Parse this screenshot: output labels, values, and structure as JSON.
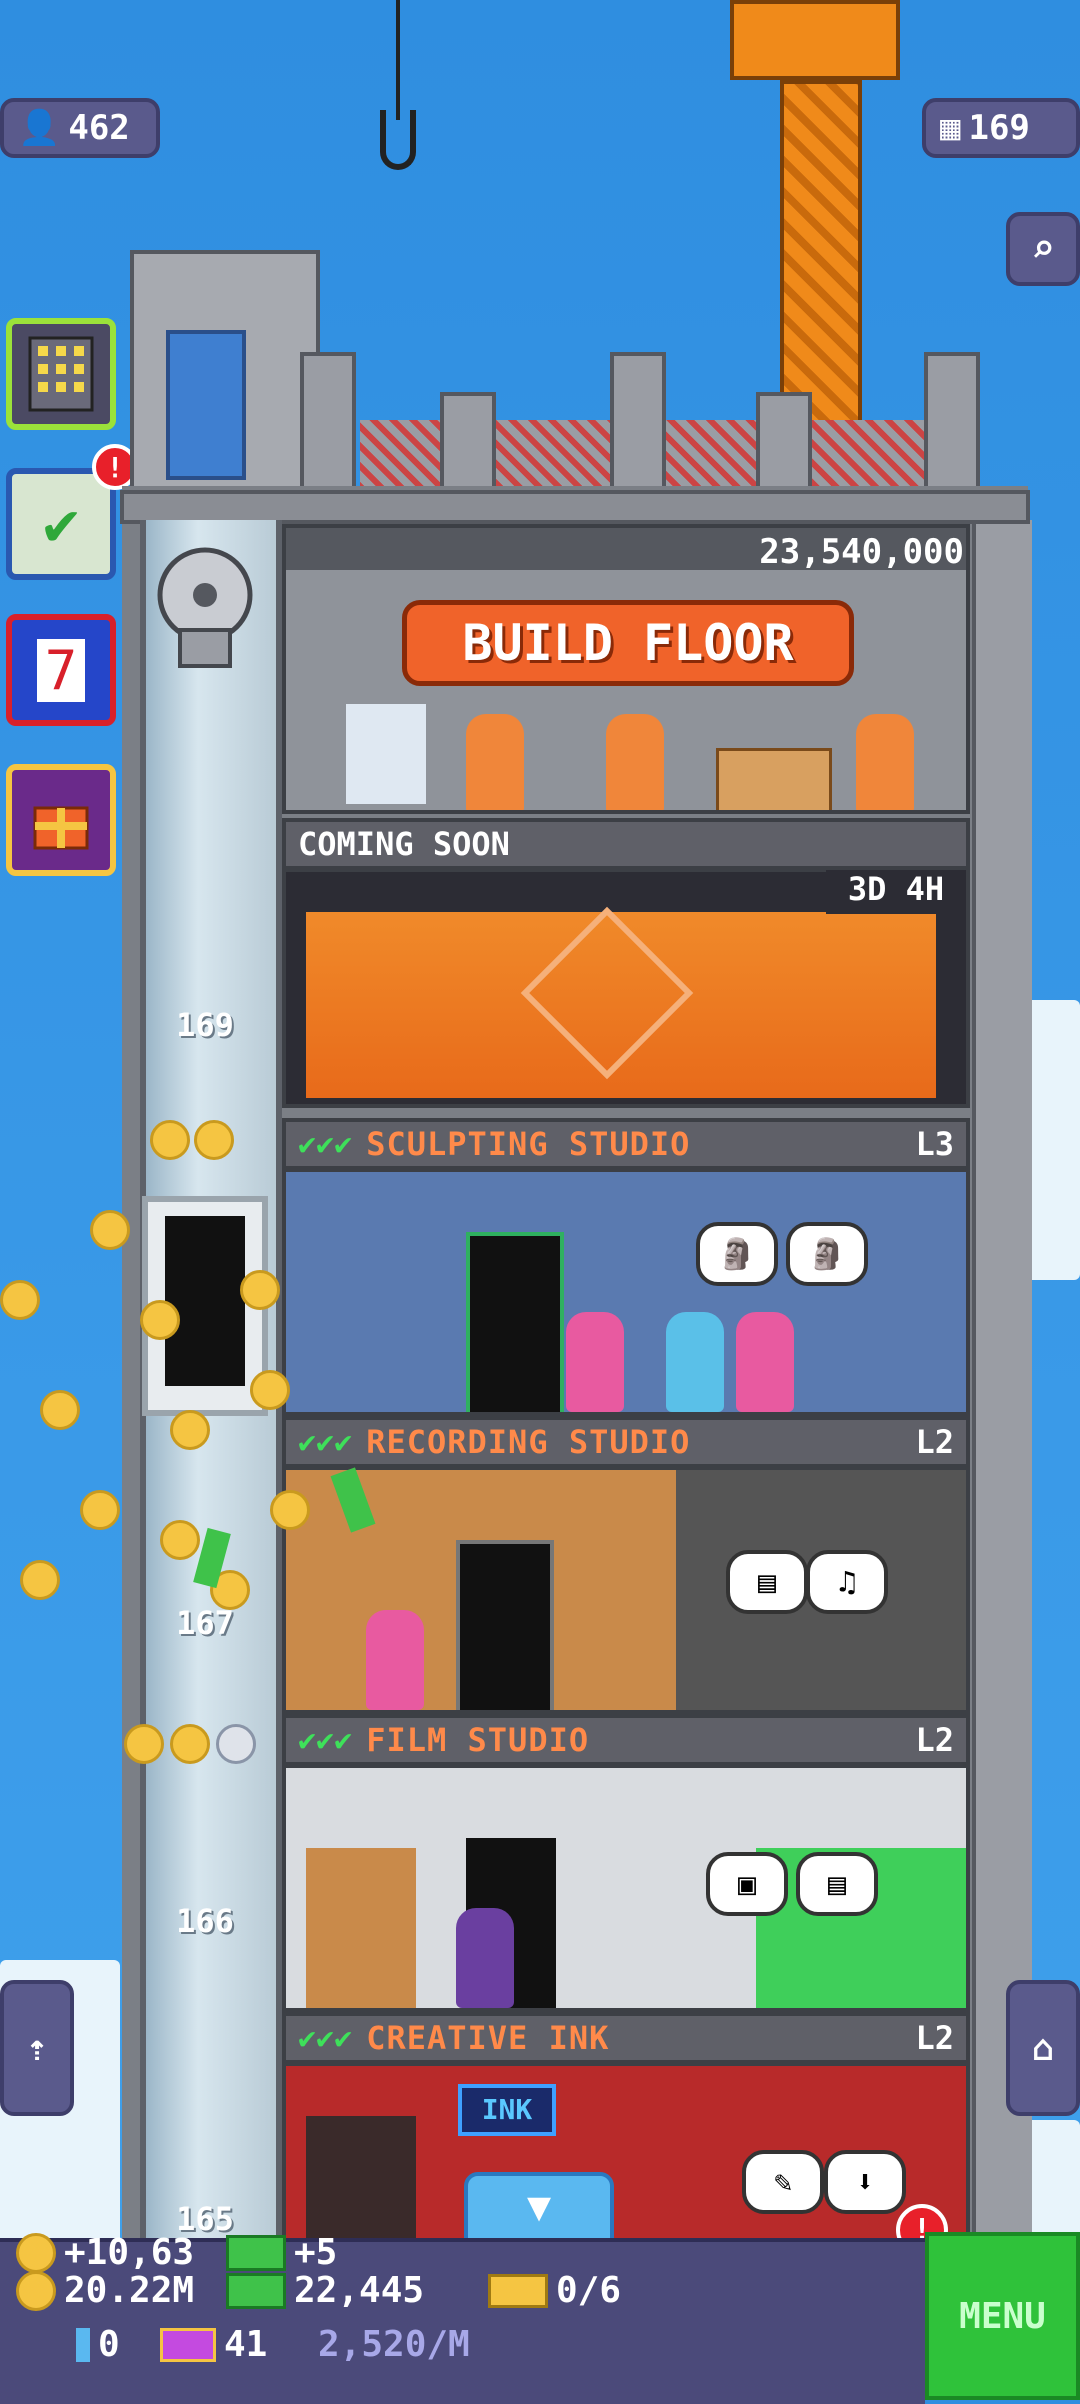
{
  "hud": {
    "residents": "462",
    "floors": "169"
  },
  "build": {
    "cost": "23,540,000",
    "button_label": "BUILD FLOOR"
  },
  "coming_soon": {
    "label": "COMING SOON",
    "timer": "3D 4H"
  },
  "floors": [
    {
      "name": "SCULPTING STUDIO",
      "level": "L3",
      "checks": "✔✔✔"
    },
    {
      "name": "RECORDING STUDIO",
      "level": "L2",
      "checks": "✔✔✔"
    },
    {
      "name": "FILM STUDIO",
      "level": "L2",
      "checks": "✔✔✔"
    },
    {
      "name": "CREATIVE INK",
      "level": "L2",
      "checks": "✔✔✔"
    }
  ],
  "elevator": {
    "numbers": [
      "169",
      "167",
      "166",
      "165"
    ]
  },
  "signs": {
    "ink": "INK"
  },
  "badges": {
    "missions_alert": "!",
    "bottom_alert": "!"
  },
  "stats": {
    "coins_rate": "+10,63",
    "bux_rate": "+5",
    "coins": "20.22M",
    "bux": "22,445",
    "tickets": "0/6",
    "keys": "0",
    "gold_tickets": "41",
    "income": "2,520/M"
  },
  "menu_label": "MENU",
  "colors": {
    "sky": "#2f8ee0",
    "build_button": "#f0632a",
    "floor_label_name": "#ff8a4a",
    "menu_button": "#2fc23a",
    "check": "#3ee05a"
  },
  "icons": [
    "person-icon",
    "building-icon",
    "search-icon",
    "floors-icon",
    "missions-icon",
    "calendar-icon",
    "gift-icon",
    "elevator-down-icon",
    "scroll-up-icon",
    "scroll-down-icon",
    "coin-icon",
    "bux-icon",
    "ticket-icon",
    "key-icon",
    "gold-ticket-icon"
  ]
}
